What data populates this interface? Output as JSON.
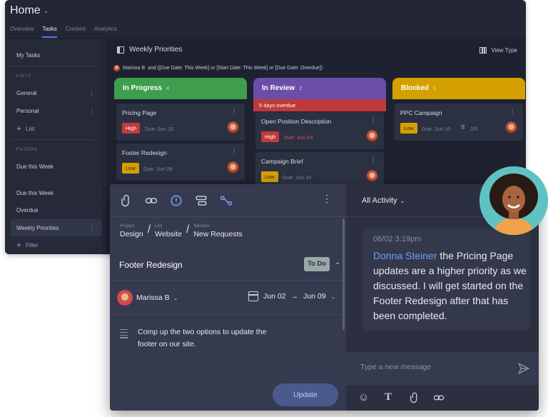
{
  "app": {
    "title": "Home",
    "tabs": [
      "Overview",
      "Tasks",
      "Content",
      "Analytics"
    ],
    "active_tab": "Tasks"
  },
  "sidebar": {
    "my_tasks": "My Tasks",
    "lists_label": "LISTS",
    "lists": [
      "General",
      "Personal"
    ],
    "add_list": "List",
    "filters_label": "FILTERS",
    "filter_items": [
      "Due this Week",
      "Due this Week",
      "Overdue",
      "Weekly Priorities"
    ],
    "add_filter": "Filter"
  },
  "board": {
    "title": "Weekly Priorities",
    "view_type": "View Type",
    "filter_user": "Marissa B",
    "filter_text": "and ([Due Date: This Week] or [Start Date: This Week] or [Due Date: Overdue])",
    "columns": [
      {
        "name": "In Progress",
        "count": "4",
        "color": "#3e9e4d",
        "cards": [
          {
            "title": "Pricing Page",
            "priority": "High",
            "due": "Due: Jun 10"
          },
          {
            "title": "Footer Redesign",
            "priority": "Low",
            "due": "Due: Jun 09"
          }
        ]
      },
      {
        "name": "In Review",
        "count": "2",
        "color": "#6a4ea8",
        "overdue_banner": "5 days overdue",
        "cards": [
          {
            "title": "Open Position Description",
            "priority": "High",
            "due": "Due: Jun 04"
          },
          {
            "title": "Campaign Brief",
            "priority": "Low",
            "due": "Due: Jun 10"
          }
        ]
      },
      {
        "name": "Blocked",
        "count": "1",
        "color": "#d4a000",
        "cards": [
          {
            "title": "PPC Campaign",
            "priority": "Low",
            "due": "Due: Jun 10",
            "subtasks": "2/5"
          }
        ]
      }
    ]
  },
  "task": {
    "breadcrumb": [
      {
        "label": "Project",
        "value": "Design"
      },
      {
        "label": "List",
        "value": "Website"
      },
      {
        "label": "Section",
        "value": "New Requests"
      }
    ],
    "title": "Footer Redesign",
    "status": "To Do",
    "assignee": "Marissa B",
    "start_date": "Jun 02",
    "due_date": "Jun 09",
    "description": "Comp up the two options to update the footer on our site.",
    "update_button": "Update"
  },
  "activity": {
    "filter": "All Activity",
    "comment": {
      "time": "06/02 3:19pm",
      "author": "Donna Steiner",
      "text": " the Pricing Page updates are a higher priority as we discussed. I will get started on the Footer Redesign after that has been completed."
    },
    "message_placeholder": "Type a new message"
  },
  "colors": {
    "accent": "#4d7cfe",
    "high": "#c0393b",
    "low": "#d4a000",
    "mention": "#6d9eff"
  },
  "icons": {
    "toolbar": [
      "paperclip-icon",
      "link-icon",
      "alert-icon",
      "subtask-icon",
      "dependency-icon"
    ],
    "composer": [
      "emoji-icon",
      "text-format-icon",
      "paperclip-icon",
      "link-icon",
      "send-icon"
    ]
  }
}
